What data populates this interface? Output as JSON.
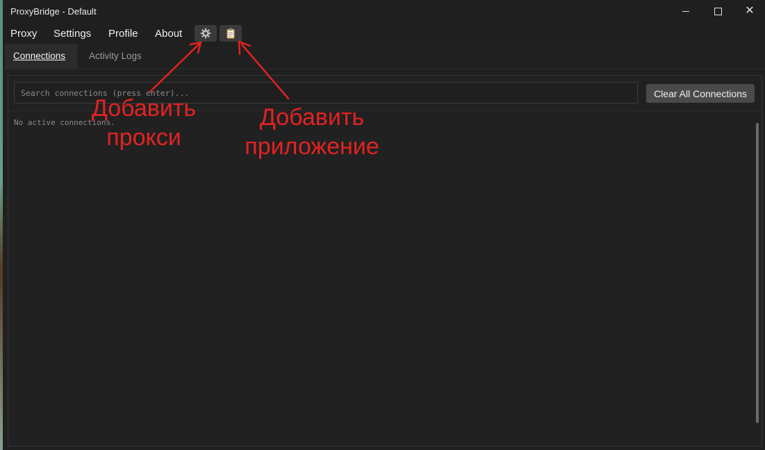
{
  "window": {
    "title": "ProxyBridge - Default",
    "controls": {
      "minimize": "",
      "maximize": "",
      "close": "✕"
    }
  },
  "menu": {
    "items": [
      "Proxy",
      "Settings",
      "Profile",
      "About"
    ],
    "icon_buttons": [
      {
        "icon": "gear-icon"
      },
      {
        "icon": "clipboard-icon"
      }
    ]
  },
  "tabs": [
    {
      "label": "Connections",
      "active": true
    },
    {
      "label": "Activity Logs",
      "active": false
    }
  ],
  "connections": {
    "search_placeholder": "Search connections (press enter)...",
    "search_value": "",
    "clear_button": "Clear All Connections",
    "empty_message": "No active connections."
  },
  "annotations": [
    {
      "text": "Добавить\nпрокси",
      "target": "gear-icon"
    },
    {
      "text": "Добавить\nприложение",
      "target": "clipboard-icon"
    }
  ],
  "colors": {
    "background": "#202020",
    "button": "#4a4a4a",
    "icon_button": "#3a3a3a",
    "annotation": "#e32222"
  }
}
